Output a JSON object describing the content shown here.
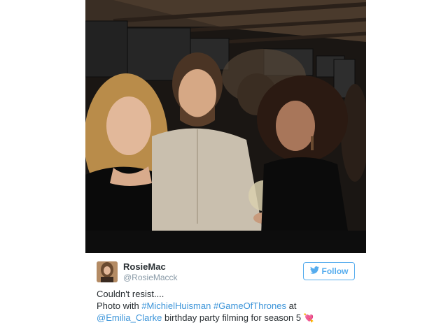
{
  "tweet": {
    "display_name": "RosieMac",
    "handle": "@RosieMacck",
    "follow_label": "Follow",
    "line1": "Couldn't resist....",
    "line2_prefix": "Photo with ",
    "hashtag1": "#MichielHuisman",
    "hashtag2": "#GameOfThrones",
    "line2_suffix": " at",
    "mention": "@Emilia_Clarke",
    "line3_suffix": " birthday party filming for season 5 ",
    "emoji": "💘"
  },
  "colors": {
    "twitter_blue": "#55acee",
    "link": "#3b94d9",
    "text": "#292f33",
    "muted": "#8899a6"
  },
  "icons": {
    "follow": "twitter-bird-icon",
    "emoji": "heart-arrow-icon"
  }
}
